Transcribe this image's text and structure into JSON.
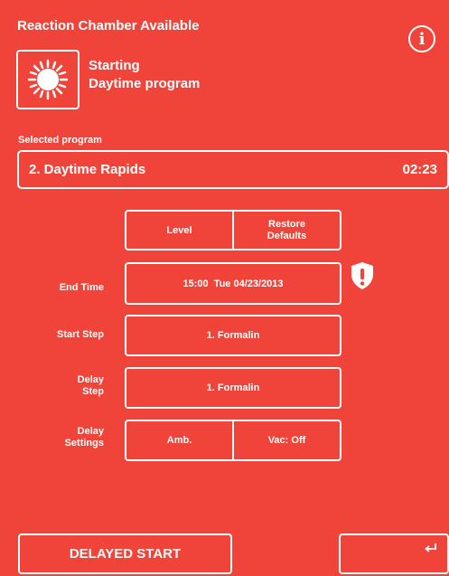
{
  "header": {
    "title": "Reaction Chamber Available",
    "info_icon": "info-icon",
    "info_glyph": "i"
  },
  "status": {
    "icon": "sun-icon",
    "line1": "Starting",
    "line2": "Daytime program"
  },
  "selected_program": {
    "label": "Selected program",
    "name": "2. Daytime Rapids",
    "duration": "02:23"
  },
  "options": {
    "level_label": "Level",
    "restore_label_1": "Restore",
    "restore_label_2": "Defaults"
  },
  "rows": {
    "end_time": {
      "label": "End Time",
      "value": "15:00  Tue 04/23/2013",
      "warning_icon": "warning-shield-icon"
    },
    "start_step": {
      "label": "Start Step",
      "value": "1. Formalin"
    },
    "delay_step": {
      "label_1": "Delay",
      "label_2": "Step",
      "value": "1. Formalin"
    },
    "delay_settings": {
      "label_1": "Delay",
      "label_2": "Settings",
      "amb": "Amb.",
      "vac": "Vac: Off"
    }
  },
  "footer": {
    "delayed_start": "DELAYED START",
    "back_icon": "return-arrow-icon"
  },
  "colors": {
    "background": "#f0443a",
    "foreground": "#ffffff"
  }
}
